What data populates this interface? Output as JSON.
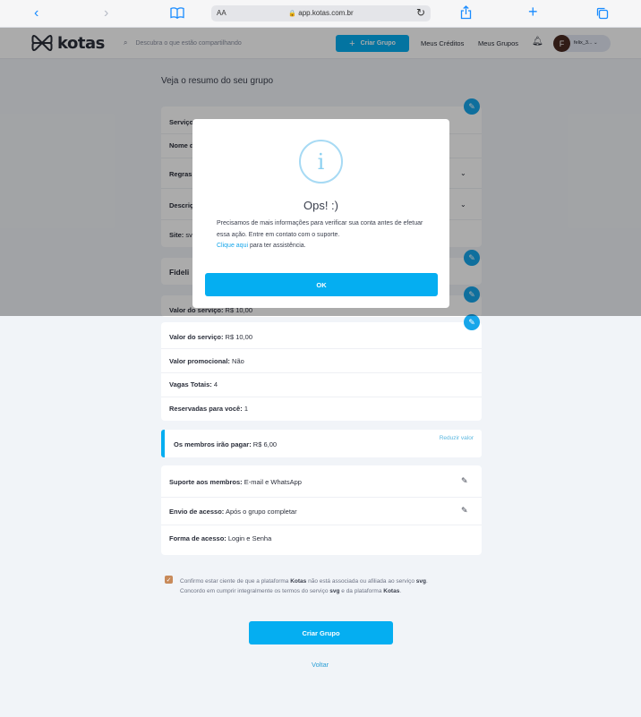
{
  "browser": {
    "text_size_label": "AA",
    "url": "app.kotas.com.br"
  },
  "header": {
    "logo_text": "kotas",
    "search_placeholder": "Descubra o que estão compartilhando",
    "create_group_label": "Criar Grupo",
    "nav_credits": "Meus Créditos",
    "nav_groups": "Meus Grupos",
    "user_initial": "F",
    "user_name": "felix_3..."
  },
  "page": {
    "title": "Veja o resumo do seu grupo",
    "summary_rows": [
      {
        "label": "Serviço"
      },
      {
        "label": "Nome d"
      },
      {
        "label": "Regras:"
      },
      {
        "label": "Descriç"
      },
      {
        "label": "Site:",
        "value": "svg"
      }
    ],
    "fidelity_label": "Fideli",
    "partial_price": {
      "label": "Valor do serviço:",
      "value": "R$ 10,00"
    },
    "pricing": [
      {
        "label": "Valor do serviço:",
        "value": "R$ 10,00"
      },
      {
        "label": "Valor promocional:",
        "value": "Não"
      },
      {
        "label": "Vagas Totais:",
        "value": "4"
      },
      {
        "label": "Reservadas para você:",
        "value": "1"
      }
    ],
    "members_pay": {
      "label": "Os membros irão pagar:",
      "value": "R$ 6,00",
      "action": "Reduzir valor"
    },
    "support": [
      {
        "label": "Suporte aos membros:",
        "value": "E-mail e WhatsApp"
      },
      {
        "label": "Envio de acesso:",
        "value": "Após o grupo completar"
      },
      {
        "label": "Forma de acesso:",
        "value": "Login e Senha"
      }
    ],
    "confirm": {
      "p1": "Confirmo estar ciente de que a plataforma ",
      "b1": "Kotas",
      "p2": " não está associada ou afiliada ao serviço ",
      "b2": "svg",
      "p3": ". Concordo em cumprir integralmente os termos do serviço ",
      "b3": "svg",
      "p4": " e da plataforma ",
      "b4": "Kotas",
      "p5": "."
    },
    "submit_label": "Criar Grupo",
    "back_label": "Voltar"
  },
  "modal": {
    "icon_glyph": "i",
    "title": "Ops! :)",
    "message": "Precisamos de mais informações para verificar sua conta antes de efetuar essa ação. Entre em contato com o suporte.",
    "link_text": "Clique aqui",
    "link_suffix": " para ter assistência.",
    "ok_label": "OK"
  },
  "colors": {
    "accent": "#05aef1",
    "overlay": "rgba(0,0,0,0.33)",
    "checkbox": "#c88a5a"
  }
}
